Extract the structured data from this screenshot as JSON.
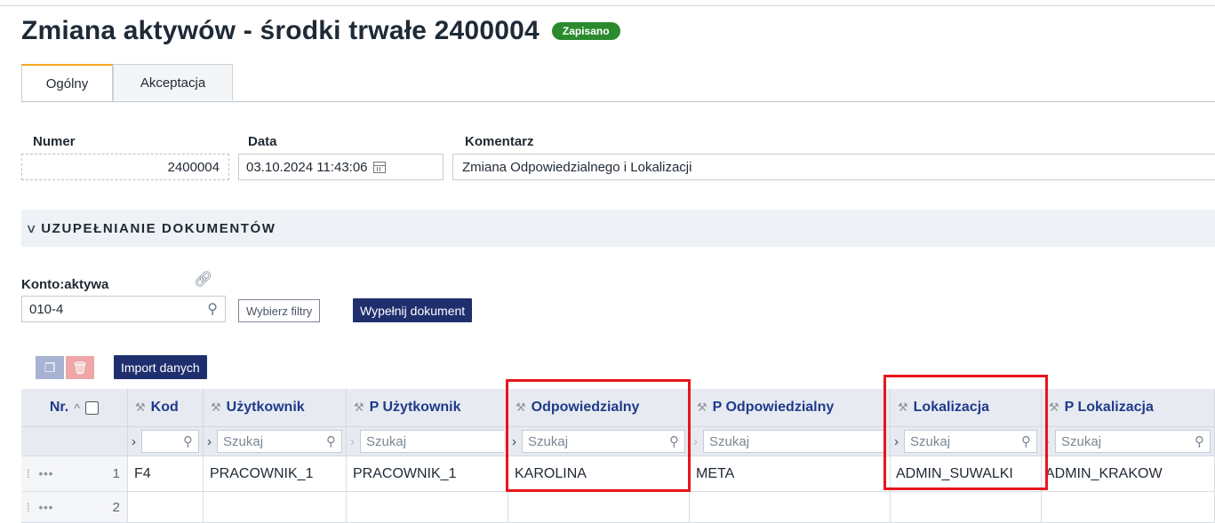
{
  "header": {
    "title": "Zmiana aktywów - środki trwałe 2400004",
    "status_badge": "Zapisano"
  },
  "tabs": [
    {
      "label": "Ogólny",
      "active": true
    },
    {
      "label": "Akceptacja",
      "active": false
    }
  ],
  "fields": {
    "numer": {
      "label": "Numer",
      "value": "2400004"
    },
    "data": {
      "label": "Data",
      "value": "03.10.2024 11:43:06"
    },
    "komentarz": {
      "label": "Komentarz",
      "value": "Zmiana Odpowiedzialnego i Lokalizacji"
    }
  },
  "section": {
    "title": "UZUPEŁNIANIE DOKUMENTÓW"
  },
  "konto": {
    "label": "Konto:aktywa",
    "value": "010-4"
  },
  "buttons": {
    "wybierz_filtry": "Wybierz filtry",
    "wypelnij_dokument": "Wypełnij dokument",
    "import_danych": "Import danych"
  },
  "grid": {
    "nr_header": "Nr.",
    "columns": [
      "Kod",
      "Użytkownik",
      "P Użytkownik",
      "Odpowiedzialny",
      "P Odpowiedzialny",
      "Lokalizacja",
      "P Lokalizacja"
    ],
    "filter_placeholder": "Szukaj",
    "rows": [
      {
        "nr": "1",
        "cells": [
          "F4",
          "PRACOWNIK_1",
          "PRACOWNIK_1",
          "KAROLINA",
          "META",
          "ADMIN_SUWALKI",
          "ADMIN_KRAKOW"
        ]
      },
      {
        "nr": "2",
        "cells": [
          "",
          "",
          "",
          "",
          "",
          "",
          ""
        ]
      }
    ]
  },
  "colors": {
    "badge": "#2c8a2e",
    "primary_button": "#1f2f6e",
    "header_link": "#1f3a8a",
    "highlight": "#e8151c",
    "active_tab": "#f5a623"
  }
}
